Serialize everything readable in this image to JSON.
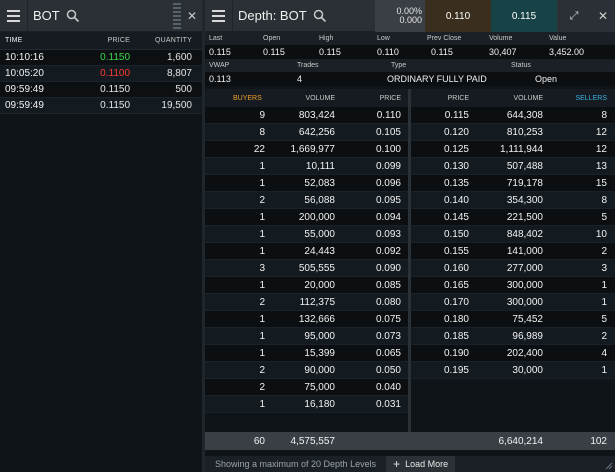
{
  "colors": {
    "up": "#3cd64a",
    "down": "#ff3b30",
    "buyers": "#f0a030",
    "sellers": "#3ab0e0"
  },
  "trades_panel": {
    "title": "BOT",
    "columns": {
      "time": "TIME",
      "price": "PRICE",
      "quantity": "QUANTITY"
    },
    "rows": [
      {
        "time": "10:10:16",
        "price": "0.1150",
        "quantity": "1,600",
        "dir": "up"
      },
      {
        "time": "10:05:20",
        "price": "0.1100",
        "quantity": "8,807",
        "dir": "down"
      },
      {
        "time": "09:59:49",
        "price": "0.1150",
        "quantity": "500",
        "dir": "none"
      },
      {
        "time": "09:59:49",
        "price": "0.1150",
        "quantity": "19,500",
        "dir": "none"
      }
    ]
  },
  "depth_panel": {
    "title": "Depth: BOT",
    "change_top": "0.00%",
    "change_bottom": "0.000",
    "bid": "0.110",
    "ask": "0.115",
    "info1": {
      "labels": [
        "Last",
        "Open",
        "High",
        "Low",
        "Prev Close",
        "Volume",
        "Value"
      ],
      "values": [
        "0.115",
        "0.115",
        "0.115",
        "0.110",
        "0.115",
        "30,407",
        "3,452.00"
      ]
    },
    "info2": {
      "labels": [
        "VWAP",
        "Trades",
        "Type",
        "Status"
      ],
      "values": [
        "0.113",
        "4",
        "ORDINARY FULLY PAID",
        "Open"
      ]
    },
    "book_headers": {
      "buyers": "BUYERS",
      "buy_volume": "VOLUME",
      "buy_price": "PRICE",
      "sell_price": "PRICE",
      "sell_volume": "VOLUME",
      "sellers": "SELLERS"
    },
    "bids": [
      {
        "count": "9",
        "volume": "803,424",
        "price": "0.110"
      },
      {
        "count": "8",
        "volume": "642,256",
        "price": "0.105"
      },
      {
        "count": "22",
        "volume": "1,669,977",
        "price": "0.100"
      },
      {
        "count": "1",
        "volume": "10,111",
        "price": "0.099"
      },
      {
        "count": "1",
        "volume": "52,083",
        "price": "0.096"
      },
      {
        "count": "2",
        "volume": "56,088",
        "price": "0.095"
      },
      {
        "count": "1",
        "volume": "200,000",
        "price": "0.094"
      },
      {
        "count": "1",
        "volume": "55,000",
        "price": "0.093"
      },
      {
        "count": "1",
        "volume": "24,443",
        "price": "0.092"
      },
      {
        "count": "3",
        "volume": "505,555",
        "price": "0.090"
      },
      {
        "count": "1",
        "volume": "20,000",
        "price": "0.085"
      },
      {
        "count": "2",
        "volume": "112,375",
        "price": "0.080"
      },
      {
        "count": "1",
        "volume": "132,666",
        "price": "0.075"
      },
      {
        "count": "1",
        "volume": "95,000",
        "price": "0.073"
      },
      {
        "count": "1",
        "volume": "15,399",
        "price": "0.065"
      },
      {
        "count": "2",
        "volume": "90,000",
        "price": "0.050"
      },
      {
        "count": "2",
        "volume": "75,000",
        "price": "0.040"
      },
      {
        "count": "1",
        "volume": "16,180",
        "price": "0.031"
      }
    ],
    "asks": [
      {
        "price": "0.115",
        "volume": "644,308",
        "count": "8"
      },
      {
        "price": "0.120",
        "volume": "810,253",
        "count": "12"
      },
      {
        "price": "0.125",
        "volume": "1,111,944",
        "count": "12"
      },
      {
        "price": "0.130",
        "volume": "507,488",
        "count": "13"
      },
      {
        "price": "0.135",
        "volume": "719,178",
        "count": "15"
      },
      {
        "price": "0.140",
        "volume": "354,300",
        "count": "8"
      },
      {
        "price": "0.145",
        "volume": "221,500",
        "count": "5"
      },
      {
        "price": "0.150",
        "volume": "848,402",
        "count": "10"
      },
      {
        "price": "0.155",
        "volume": "141,000",
        "count": "2"
      },
      {
        "price": "0.160",
        "volume": "277,000",
        "count": "3"
      },
      {
        "price": "0.165",
        "volume": "300,000",
        "count": "1"
      },
      {
        "price": "0.170",
        "volume": "300,000",
        "count": "1"
      },
      {
        "price": "0.180",
        "volume": "75,452",
        "count": "5"
      },
      {
        "price": "0.185",
        "volume": "96,989",
        "count": "2"
      },
      {
        "price": "0.190",
        "volume": "202,400",
        "count": "4"
      },
      {
        "price": "0.195",
        "volume": "30,000",
        "count": "1"
      }
    ],
    "totals": {
      "buy_count": "60",
      "buy_volume": "4,575,557",
      "sell_volume": "6,640,214",
      "sell_count": "102"
    },
    "footer_text": "Showing a maximum of 20 Depth Levels",
    "load_more_label": "Load More"
  }
}
